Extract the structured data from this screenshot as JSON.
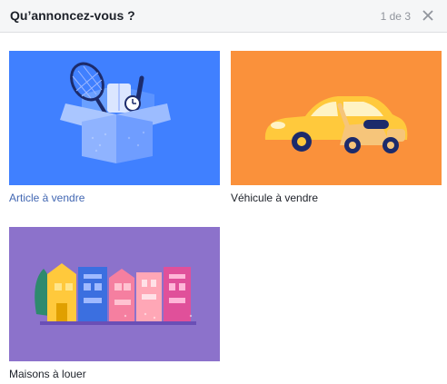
{
  "dialog": {
    "title": "Qu’annoncez-vous ?",
    "pager": "1 de 3",
    "close_icon": "close-icon"
  },
  "categories": [
    {
      "label": "Article à vendre",
      "color": "#4080ff",
      "icon": "open-box-icon"
    },
    {
      "label": "Véhicule à vendre",
      "color": "#fa913b",
      "icon": "car-scooter-icon"
    },
    {
      "label": "Maisons à louer",
      "color": "#8c72cb",
      "icon": "houses-icon"
    }
  ],
  "colors": {
    "header_bg": "#f5f6f7",
    "link_blue": "#4267b2"
  }
}
